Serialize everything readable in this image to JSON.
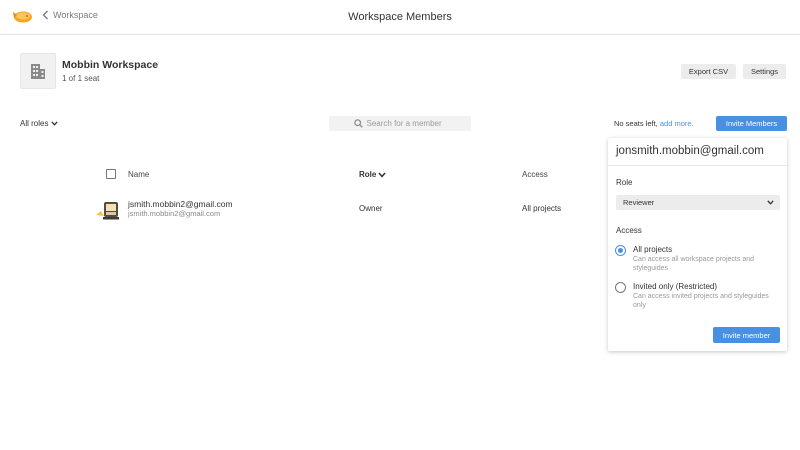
{
  "header": {
    "back_label": "Workspace",
    "title": "Workspace Members"
  },
  "workspace": {
    "name": "Mobbin Workspace",
    "seats": "1 of 1 seat",
    "export_label": "Export CSV",
    "settings_label": "Settings"
  },
  "filters": {
    "roles_label": "All roles",
    "search_placeholder": "Search for a member",
    "no_seats_text": "No seats left,",
    "add_more_link": "add more.",
    "invite_members_label": "Invite Members"
  },
  "table": {
    "headers": {
      "name": "Name",
      "role": "Role",
      "access": "Access"
    },
    "rows": [
      {
        "name": "jsmith.mobbin2@gmail.com",
        "email": "jsmith.mobbin2@gmail.com",
        "role": "Owner",
        "access": "All projects"
      }
    ]
  },
  "invite_popover": {
    "email": "jonsmith.mobbin@gmail.com",
    "role_label": "Role",
    "role_value": "Reviewer",
    "access_label": "Access",
    "options": [
      {
        "title": "All projects",
        "description": "Can access all workspace projects and styleguides",
        "selected": true
      },
      {
        "title": "Invited only (Restricted)",
        "description": "Can access invited projects and styleguides only",
        "selected": false
      }
    ],
    "submit_label": "Invite member"
  },
  "colors": {
    "accent": "#4a90e2",
    "button_grey": "#ececec",
    "search_bg": "#f2f2f2"
  },
  "icons": [
    "zeplin-logo-icon",
    "chevron-left-icon",
    "building-icon",
    "chevron-down-icon",
    "search-icon",
    "member-avatar-icon"
  ]
}
